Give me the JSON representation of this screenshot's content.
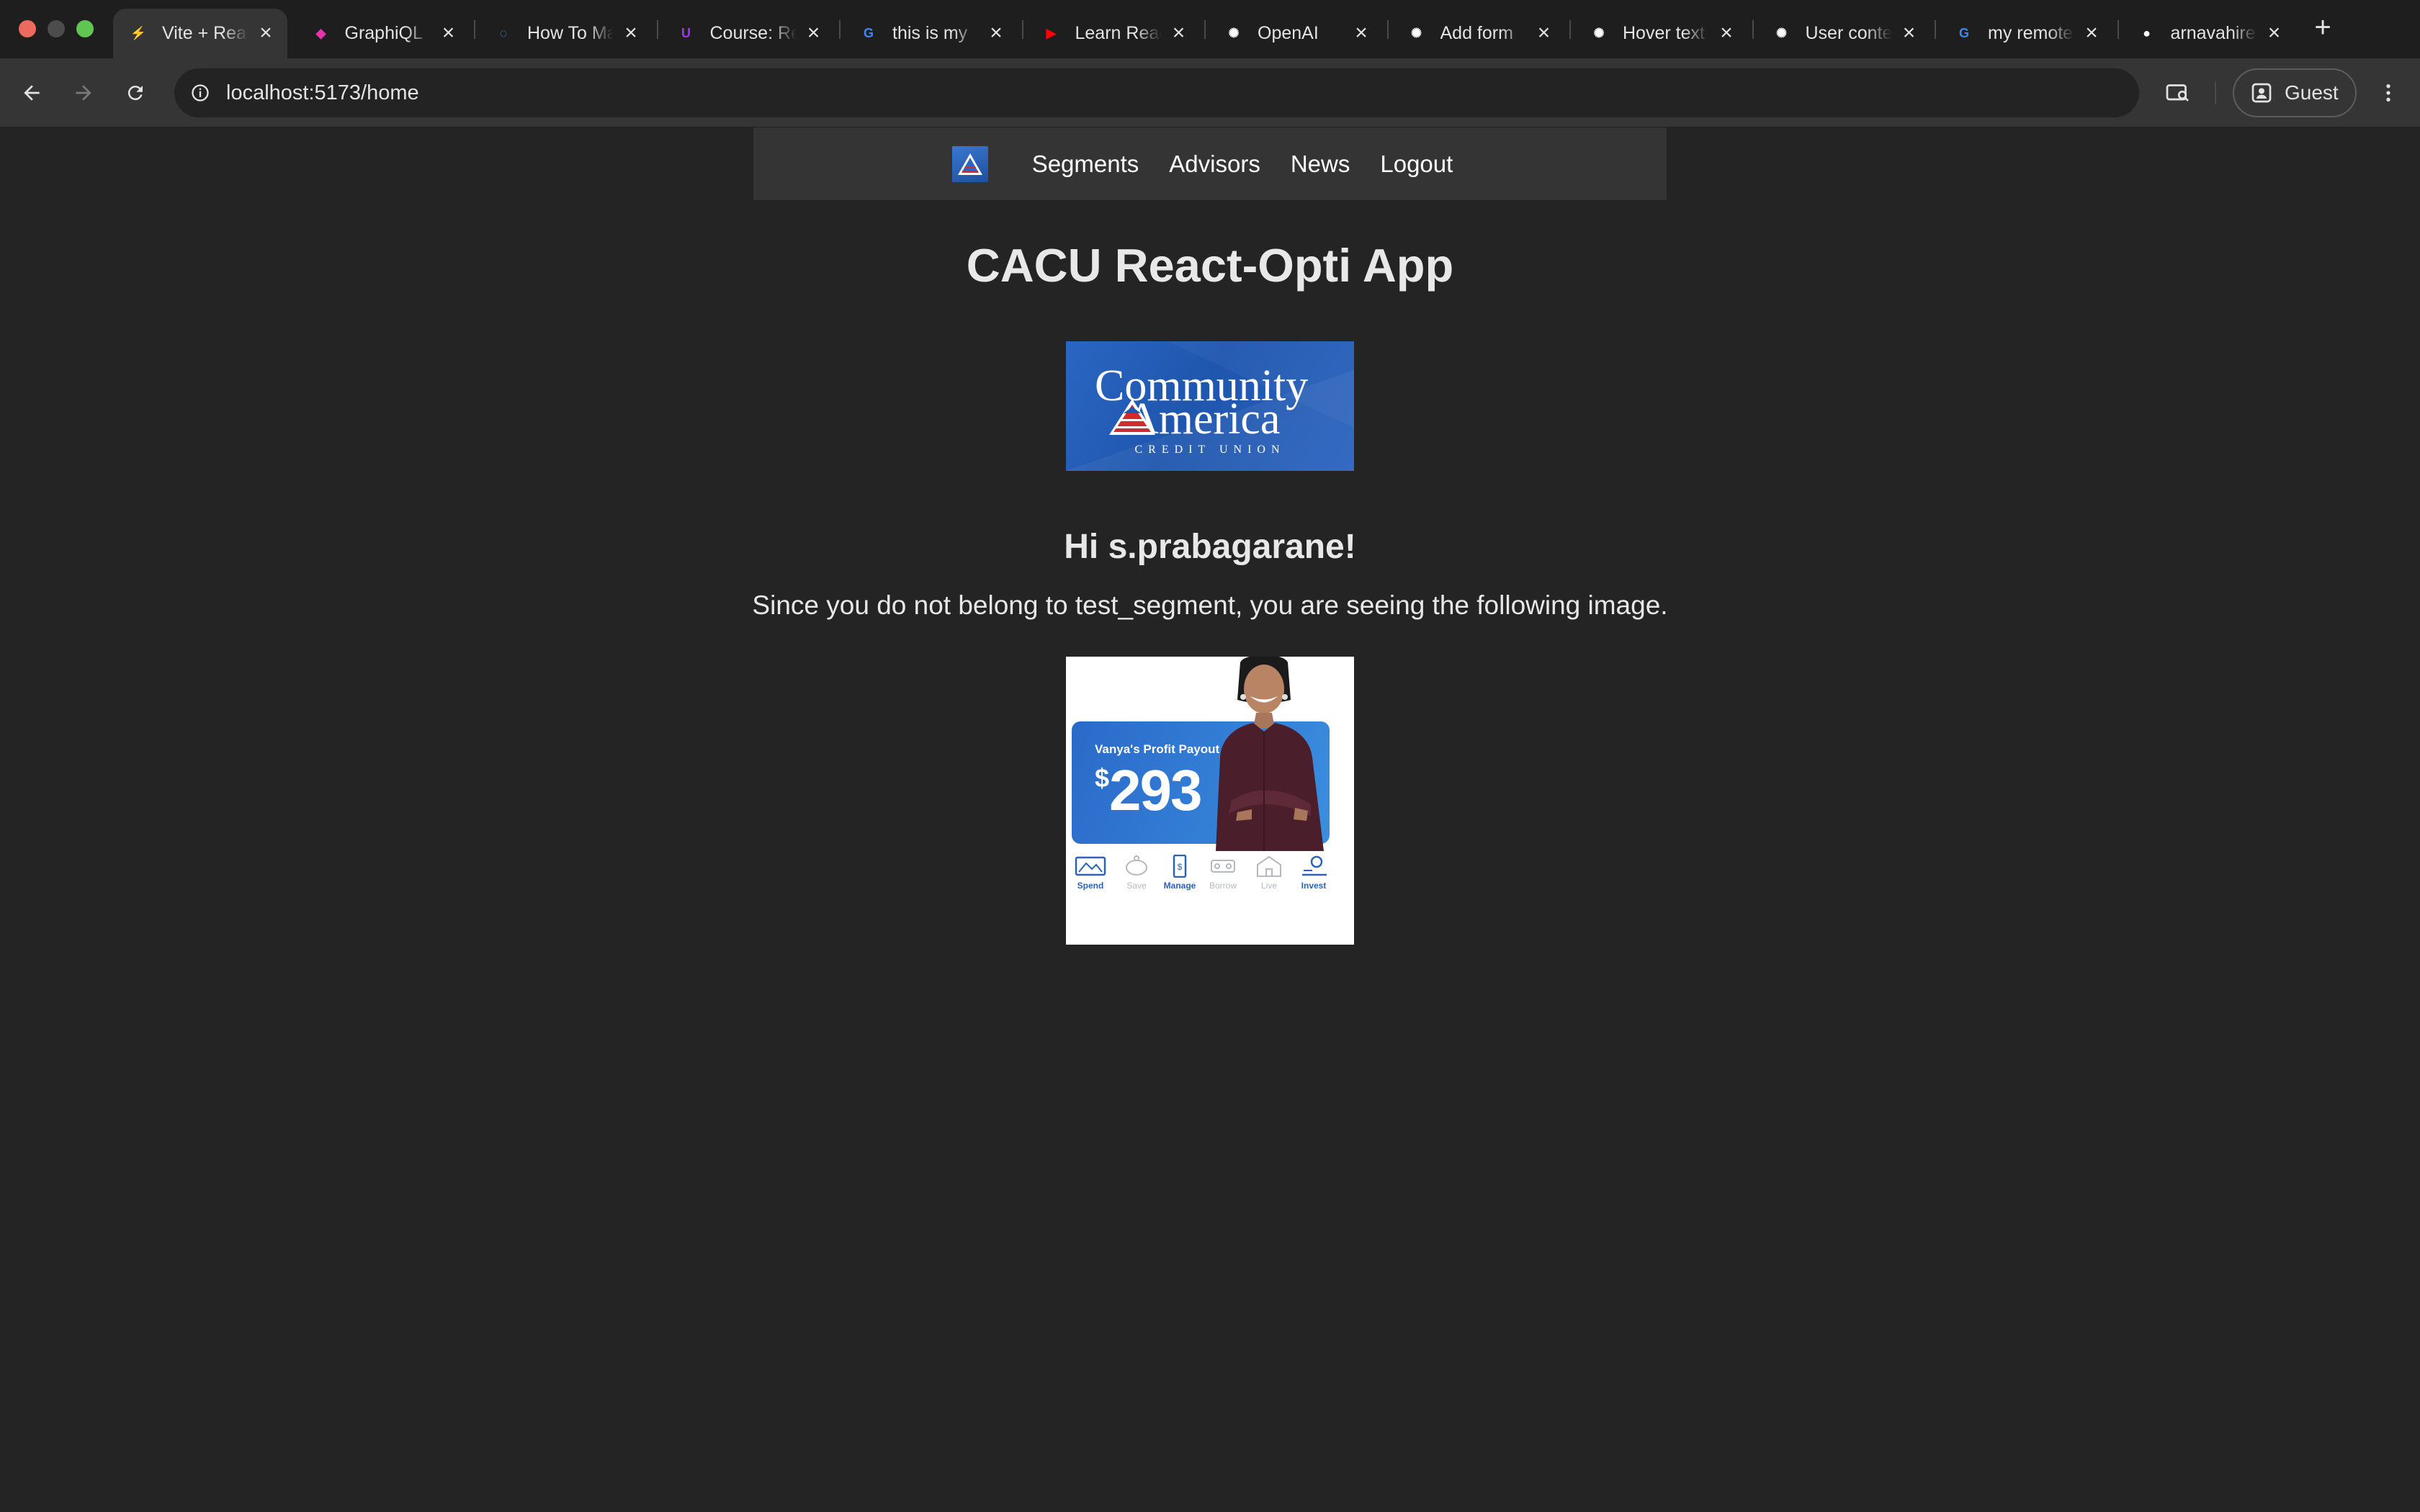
{
  "browser": {
    "tabs": [
      {
        "title": "Vite + React + TS",
        "active": true,
        "favicon": "vite-icon",
        "color": "#a96bff"
      },
      {
        "title": "GraphiQL",
        "active": false,
        "favicon": "graphiql-icon",
        "color": "#e535ab"
      },
      {
        "title": "How To Make",
        "active": false,
        "favicon": "loading-icon",
        "color": "#4a8cf0"
      },
      {
        "title": "Course: React",
        "active": false,
        "favicon": "udemy-icon",
        "color": "#a435f0"
      },
      {
        "title": "this is my",
        "active": false,
        "favicon": "google-icon",
        "color": "#4285f4"
      },
      {
        "title": "Learn React",
        "active": false,
        "favicon": "youtube-icon",
        "color": "#ff0000"
      },
      {
        "title": "OpenAI",
        "active": false,
        "favicon": "openai-icon",
        "color": "#ffffff"
      },
      {
        "title": "Add form",
        "active": false,
        "favicon": "openai-icon",
        "color": "#ffffff"
      },
      {
        "title": "Hover text",
        "active": false,
        "favicon": "openai-icon",
        "color": "#ffffff"
      },
      {
        "title": "User context",
        "active": false,
        "favicon": "openai-icon",
        "color": "#ffffff"
      },
      {
        "title": "my remote",
        "active": false,
        "favicon": "google-icon",
        "color": "#4285f4"
      },
      {
        "title": "arnavahire",
        "active": false,
        "favicon": "github-icon",
        "color": "#ffffff"
      }
    ],
    "url": "localhost:5173/home",
    "profile_label": "Guest"
  },
  "nav": {
    "links": [
      "Segments",
      "Advisors",
      "News",
      "Logout"
    ]
  },
  "main": {
    "title": "CACU React-Opti App",
    "brand": {
      "line1": "Community",
      "line2": "America",
      "line3": "CREDIT UNION"
    },
    "greeting": "Hi s.prabagarane!",
    "message": "Since you do not belong to test_segment, you are seeing the following image.",
    "promo": {
      "caption": "Vanya's Profit Payout",
      "currency": "$",
      "amount": "293",
      "categories": [
        {
          "label": "Spend",
          "active": true,
          "icon": "card-icon"
        },
        {
          "label": "Save",
          "active": false,
          "icon": "piggy-bank-icon"
        },
        {
          "label": "Manage",
          "active": true,
          "icon": "phone-icon"
        },
        {
          "label": "Borrow",
          "active": false,
          "icon": "car-icon"
        },
        {
          "label": "Live",
          "active": false,
          "icon": "house-icon"
        },
        {
          "label": "Invest",
          "active": true,
          "icon": "invest-icon"
        }
      ]
    }
  },
  "colors": {
    "page_bg": "#242424",
    "navbar_bg": "#343434",
    "brand_blue": "#2a66c2",
    "brand_red": "#d12a2f"
  }
}
